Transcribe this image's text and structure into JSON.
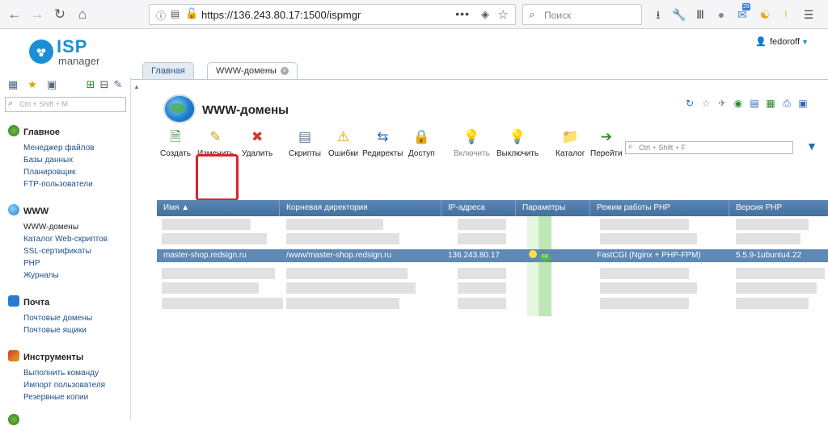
{
  "browser": {
    "url_host": "https://136.243.80.17",
    "url_rest": ":1500/ispmgr",
    "search_placeholder": "Поиск",
    "mail_badge": "29"
  },
  "app": {
    "logo_top": "ISP",
    "logo_bottom": "manager",
    "user": "fedoroff"
  },
  "tabs": [
    {
      "label": "Главная"
    },
    {
      "label": "WWW-домены"
    }
  ],
  "sidebar": {
    "search_placeholder": "Ctrl + Shift + M",
    "groups": [
      {
        "title": "Главное",
        "items": [
          "Менеджер файлов",
          "Базы данных",
          "Планировщик",
          "FTP-пользователи"
        ]
      },
      {
        "title": "WWW",
        "items": [
          "WWW-домены",
          "Каталог Web-скриптов",
          "SSL-сертификаты",
          "PHP",
          "Журналы"
        ]
      },
      {
        "title": "Почта",
        "items": [
          "Почтовые домены",
          "Почтовые ящики"
        ]
      },
      {
        "title": "Инструменты",
        "items": [
          "Выполнить команду",
          "Импорт пользователя",
          "Резервные копии"
        ]
      }
    ]
  },
  "page": {
    "title": "WWW-домены",
    "filter_placeholder": "Ctrl + Shift + F"
  },
  "toolbar": {
    "create": "Создать",
    "edit": "Изменить",
    "delete": "Удалить",
    "scripts": "Скрипты",
    "errors": "Ошибки",
    "redirects": "Редиректы",
    "access": "Доступ",
    "enable": "Включить",
    "disable": "Выключить",
    "catalog": "Каталог",
    "goto": "Перейти"
  },
  "table": {
    "columns": [
      "Имя ▲",
      "Корневая директория",
      "IP-адреса",
      "Параметры",
      "Режим работы PHP",
      "Версия PHP"
    ],
    "selected_row": {
      "name": "master-shop.redsign.ru",
      "root": "/www/master-shop.redsign.ru",
      "ip": "136.243.80.17",
      "php_mode": "FastCGI (Nginx + PHP-FPM)",
      "php_version": "5.5.9-1ubuntu4.22",
      "fp_label": "FP"
    }
  },
  "colors": {
    "accent": "#1a8fd6",
    "header": "#4f7dad",
    "selected": "#5f88b4",
    "highlight": "#d9262c"
  }
}
